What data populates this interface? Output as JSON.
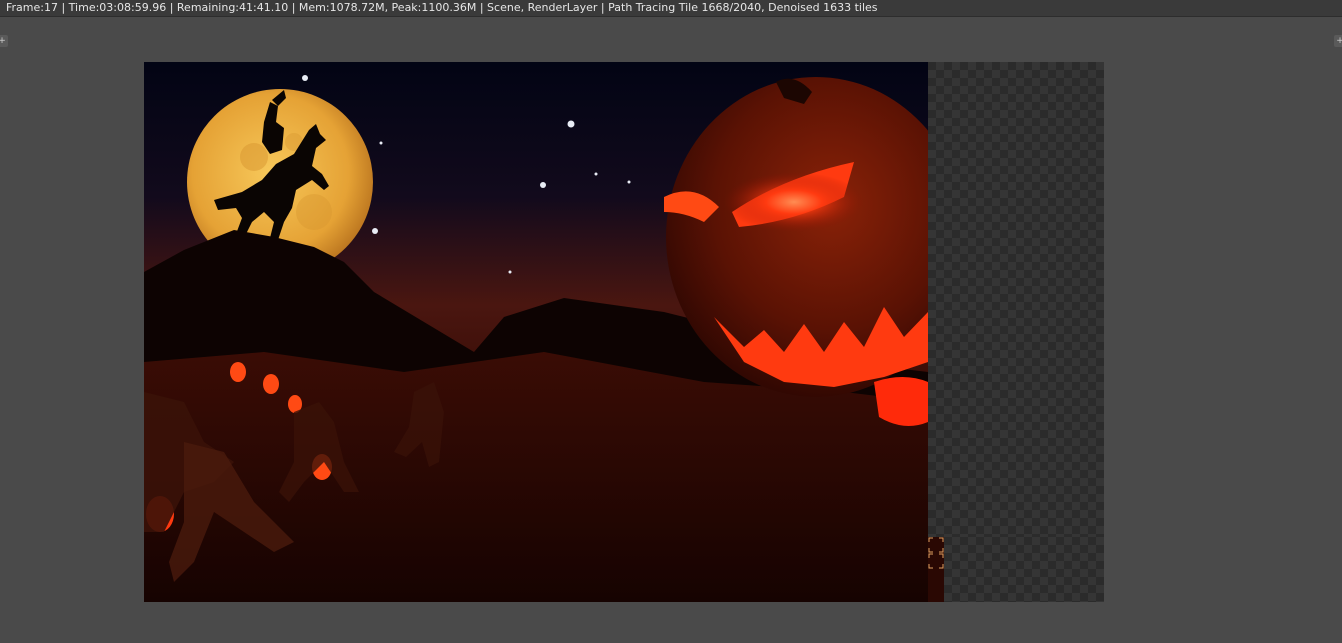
{
  "status_bar": {
    "text": "Frame:17 | Time:03:08:59.96 | Remaining:41:41.10 | Mem:1078.72M, Peak:1100.36M | Scene, RenderLayer | Path Tracing Tile 1668/2040, Denoised 1633 tiles"
  },
  "corner_buttons": {
    "left_icon": "plus-icon",
    "right_icon": "plus-icon",
    "glyph": "+"
  },
  "render": {
    "subject": "Halloween scene render in progress",
    "background_transparent_pattern": "checkerboard",
    "colors": {
      "sky_top": "#030515",
      "sky_horizon": "#5a1a0e",
      "moon": "#f2b541",
      "pumpkin": "#7a1a08",
      "glow": "#ff3a10",
      "ground": "#240602"
    }
  }
}
